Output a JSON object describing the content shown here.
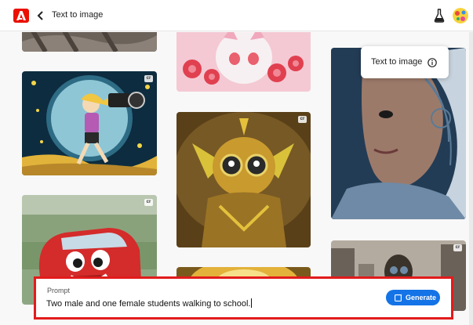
{
  "header": {
    "title": "Text to image",
    "app_icon": "adobe-logo",
    "back_icon": "chevron-left-icon",
    "labs_icon": "flask-icon",
    "avatar_icon": "user-avatar"
  },
  "tooltip": {
    "label": "Text to image",
    "icon": "info-icon"
  },
  "gallery": {
    "badge_label": "cr",
    "items": [
      {
        "name": "shadowed-feet",
        "colors": [
          "#5a5148",
          "#8b8178"
        ]
      },
      {
        "name": "cartoon-photographer-girl",
        "colors": [
          "#0f5a76",
          "#f2cf3a"
        ]
      },
      {
        "name": "red-cartoon-car",
        "colors": [
          "#d42b2b",
          "#6b8a5a"
        ]
      },
      {
        "name": "pink-cat-with-flowers",
        "colors": [
          "#f4c9d4",
          "#e9606e"
        ]
      },
      {
        "name": "golden-robot-character",
        "colors": [
          "#6b4b1e",
          "#d6b13c"
        ]
      },
      {
        "name": "golden-glow-scene",
        "colors": [
          "#e3b23a",
          "#7a5a1c"
        ]
      },
      {
        "name": "cyborg-woman-portrait",
        "colors": [
          "#1d3a55",
          "#7aa3c2"
        ]
      },
      {
        "name": "gas-mask-soldier-ruins",
        "colors": [
          "#6a6258",
          "#b3aba0"
        ]
      }
    ]
  },
  "prompt": {
    "label": "Prompt",
    "value": "Two male and one female students walking to school.",
    "button_label": "Generate",
    "button_icon": "generate-icon",
    "highlight_color": "#e21b1b",
    "accent_color": "#1473e6"
  }
}
